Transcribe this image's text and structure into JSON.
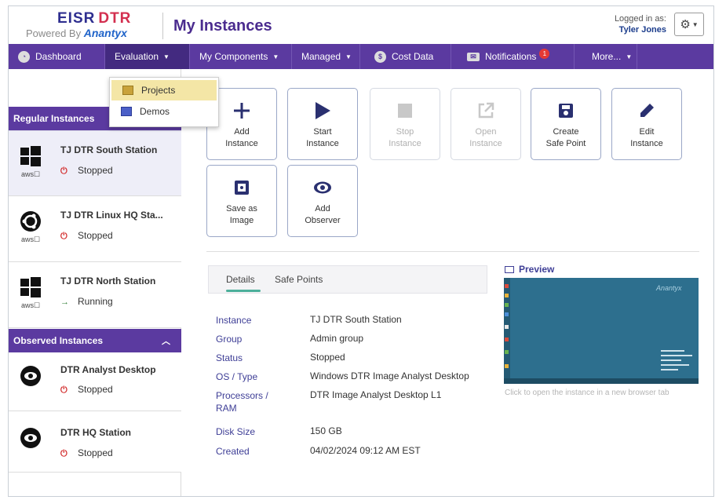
{
  "header": {
    "logo_eisr": "EISR",
    "logo_dtr": "DTR",
    "powered_by": "Powered By",
    "brand": "Anantyx",
    "title": "My Instances",
    "logged_in_label": "Logged in as:",
    "user_name": "Tyler Jones"
  },
  "nav": {
    "items": [
      {
        "label": "Dashboard",
        "icon": "dashboard-icon"
      },
      {
        "label": "Evaluation",
        "icon": ""
      },
      {
        "label": "My Components",
        "icon": ""
      },
      {
        "label": "Managed",
        "icon": ""
      },
      {
        "label": "Cost Data",
        "icon": "dollar-icon"
      },
      {
        "label": "Notifications",
        "icon": "mail-icon",
        "badge": "1"
      },
      {
        "label": "More...",
        "icon": ""
      }
    ]
  },
  "dropdown": {
    "items": [
      {
        "label": "Projects"
      },
      {
        "label": "Demos"
      }
    ]
  },
  "sidebar": {
    "regular_header": "Regular Instances",
    "observed_header": "Observed Instances",
    "regular": [
      {
        "name": "TJ DTR South Station",
        "status": "Stopped",
        "os": "windows-icon",
        "cloud": "aws"
      },
      {
        "name": "TJ DTR Linux HQ Sta...",
        "status": "Stopped",
        "os": "ubuntu-icon",
        "cloud": "aws"
      },
      {
        "name": "TJ DTR North Station",
        "status": "Running",
        "os": "windows-icon",
        "cloud": "aws"
      }
    ],
    "observed": [
      {
        "name": "DTR Analyst Desktop",
        "status": "Stopped"
      },
      {
        "name": "DTR HQ Station",
        "status": "Stopped"
      }
    ]
  },
  "toolbar": {
    "add_l1": "Add",
    "add_l2": "Instance",
    "start_l1": "Start",
    "start_l2": "Instance",
    "stop_l1": "Stop",
    "stop_l2": "Instance",
    "open_l1": "Open",
    "open_l2": "Instance",
    "safe_l1": "Create",
    "safe_l2": "Safe Point",
    "edit_l1": "Edit",
    "edit_l2": "Instance",
    "image_l1": "Save as",
    "image_l2": "Image",
    "observer_l1": "Add",
    "observer_l2": "Observer"
  },
  "tabs": {
    "details": "Details",
    "safe_points": "Safe Points"
  },
  "details": {
    "instance_k": "Instance",
    "instance_v": "TJ DTR South Station",
    "group_k": "Group",
    "group_v": "Admin group",
    "status_k": "Status",
    "status_v": "Stopped",
    "os_k": "OS / Type",
    "os_v": "Windows DTR Image Analyst Desktop",
    "proc_k": "Processors / RAM",
    "proc_v": "DTR Image Analyst Desktop L1",
    "disk_k": "Disk Size",
    "disk_v": "150 GB",
    "created_k": "Created",
    "created_v": "04/02/2024 09:12 AM EST"
  },
  "preview": {
    "title": "Preview",
    "caption": "Click to open the instance in a new browser tab",
    "watermark": "Anantyx"
  },
  "colors": {
    "nav_purple": "#5b3aa0",
    "title_purple": "#4b2c8f",
    "stopped_red": "#d32f2f",
    "running_green": "#2e7d32"
  }
}
